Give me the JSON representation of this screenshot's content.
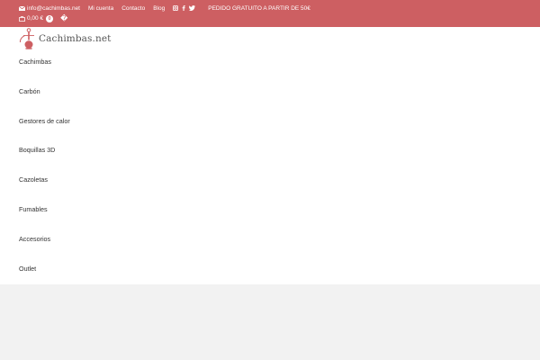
{
  "topbar": {
    "email": "info@cachimbas.net",
    "links": [
      "Mi cuenta",
      "Contacto",
      "Blog"
    ],
    "promo": "PEDIDO GRATUITO A PARTIR DE 50€",
    "cart_total": "0,00 €",
    "cart_count": "0",
    "lang_glyph": "�"
  },
  "logo": {
    "text": "Cachimbas.net"
  },
  "menu": {
    "items": [
      "Cachimbas",
      "Carbón",
      "Gestores de calor",
      "Boquillas 3D",
      "Cazoletas",
      "Fumables",
      "Accesorios",
      "Outlet"
    ]
  },
  "colors": {
    "topbar": "#cd5f62",
    "logo_icon": "#cd5f62",
    "footer_band": "#f2f2f2"
  },
  "icons": [
    "envelope-icon",
    "instagram-icon",
    "facebook-icon",
    "twitter-icon",
    "cart-icon",
    "hookah-logo-icon"
  ]
}
